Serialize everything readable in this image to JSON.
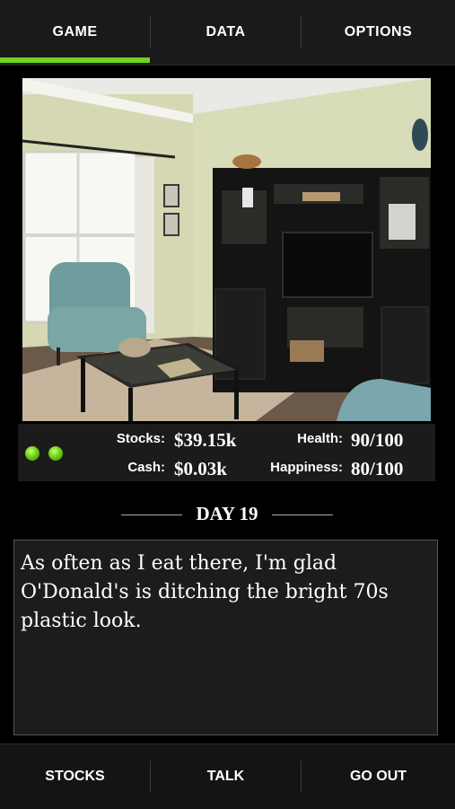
{
  "top_tabs": [
    {
      "label": "GAME",
      "active": true
    },
    {
      "label": "DATA",
      "active": false
    },
    {
      "label": "OPTIONS",
      "active": false
    }
  ],
  "colors": {
    "accent": "#6dd41e",
    "background": "#000000"
  },
  "scene": {
    "description_icon": "living-room-image"
  },
  "status_indicators": {
    "lights": [
      "green",
      "green"
    ]
  },
  "stats": {
    "stocks_label": "Stocks:",
    "stocks_value": "$39.15k",
    "cash_label": "Cash:",
    "cash_value": "$0.03k",
    "health_label": "Health:",
    "health_value": "90/100",
    "happiness_label": "Happiness:",
    "happiness_value": "80/100"
  },
  "day": {
    "title": "DAY 19"
  },
  "message": {
    "text": "As often as I eat there, I'm glad O'Donald's is ditching the bright 70s plastic look."
  },
  "bottom_tabs": [
    {
      "label": "STOCKS"
    },
    {
      "label": "TALK"
    },
    {
      "label": "GO OUT"
    }
  ]
}
